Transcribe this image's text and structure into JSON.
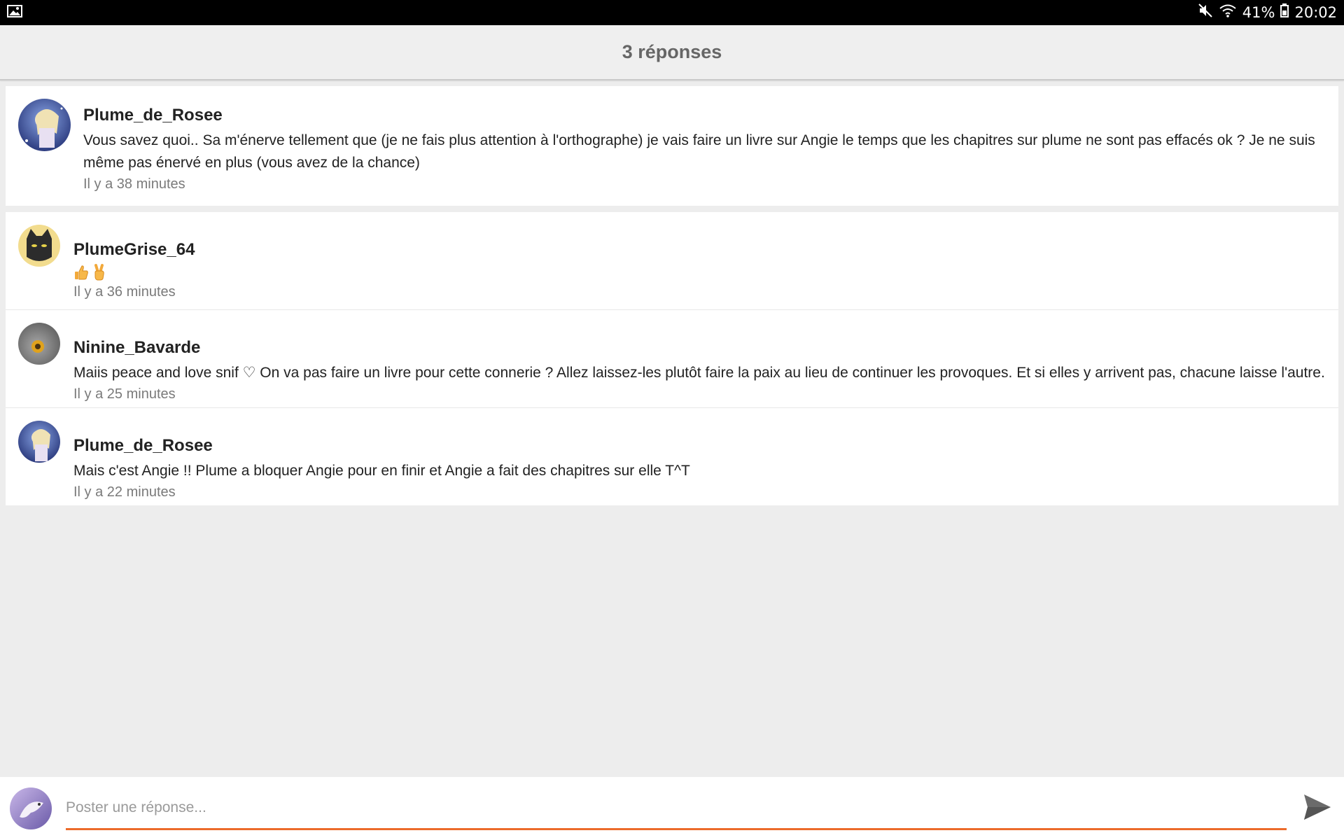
{
  "status_bar": {
    "battery": "41%",
    "time": "20:02",
    "icons": [
      "image-icon",
      "mute-icon",
      "wifi-icon",
      "battery-icon"
    ]
  },
  "header": {
    "title": "3 réponses"
  },
  "root_comment": {
    "author": "Plume_de_Rosee",
    "text": "Vous savez quoi.. Sa m'énerve tellement que (je ne fais plus attention à l'orthographe) je vais faire un livre sur Angie le temps que les chapitres sur plume ne sont pas effacés ok ? Je ne suis même pas énervé en plus (vous avez de la chance)",
    "time": "Il y a 38 minutes"
  },
  "replies": [
    {
      "author": "PlumeGrise_64",
      "emojis": [
        "thumbs-up-emoji",
        "victory-hand-emoji"
      ],
      "time": "Il y a 36 minutes"
    },
    {
      "author": "Ninine_Bavarde",
      "text": "Maiis peace and love snif ♡ On va pas faire un livre pour cette connerie ? Allez laissez-les plutôt faire la paix au lieu de continuer les provoques. Et si elles y arrivent pas, chacune laisse l'autre.",
      "time": "Il y a 25 minutes"
    },
    {
      "author": "Plume_de_Rosee",
      "text": "Mais c'est Angie !! Plume a bloquer Angie pour en finir et Angie a fait des chapitres sur elle T^T",
      "time": "Il y a 22 minutes"
    }
  ],
  "composer": {
    "placeholder": "Poster une réponse...",
    "value": ""
  },
  "colors": {
    "accent": "#ec6b2b",
    "background": "#ededed",
    "status_bar": "#000000"
  }
}
